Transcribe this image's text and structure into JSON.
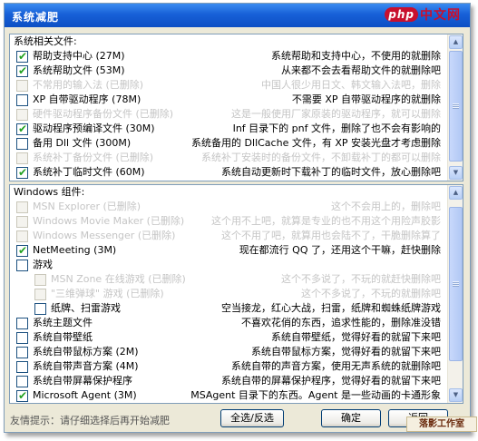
{
  "window": {
    "title": "系统减肥"
  },
  "watermark_top": {
    "logo": "php",
    "text": "中文网"
  },
  "watermark_bottom": {
    "text": "落影工作室"
  },
  "groups": {
    "system_files": {
      "label": "系统相关文件:",
      "items": [
        {
          "name": "帮助支持中心 (27M)",
          "desc": "系统帮助和支持中心，不使用的就删除",
          "checked": true,
          "disabled": false
        },
        {
          "name": "系统帮助文件 (53M)",
          "desc": "从来都不会去看帮助文件的就删除吧",
          "checked": true,
          "disabled": false
        },
        {
          "name": "不常用的输入法 (已删除)",
          "desc": "中国人很少用日文、韩文输入法吧，删除",
          "checked": false,
          "disabled": true
        },
        {
          "name": "XP 自带驱动程序 (78M)",
          "desc": "不需要 XP 自带驱动程序的就删除",
          "checked": false,
          "disabled": false
        },
        {
          "name": "硬件驱动程序备份文件 (已删除)",
          "desc": "这是一般使用厂家原装的驱动程序，就可以删除",
          "checked": false,
          "disabled": true
        },
        {
          "name": "驱动程序预编译文件 (30M)",
          "desc": "Inf 目录下的 pnf 文件，删除了也不会有影响的",
          "checked": true,
          "disabled": false
        },
        {
          "name": "备用 Dll 文件 (300M)",
          "desc": "系统备用的 DllCache 文件，有 XP 安装光盘才考虑删除",
          "checked": false,
          "disabled": false
        },
        {
          "name": "系统补丁备份文件 (已删除)",
          "desc": "系统补丁安装时的备份文件，不卸载补丁的都可以删除",
          "checked": false,
          "disabled": true
        },
        {
          "name": "系统补丁临时文件 (60M)",
          "desc": "系统自动更新时下载补丁的临时文件，放心删除吧",
          "checked": true,
          "disabled": false
        }
      ]
    },
    "windows_components": {
      "label": "Windows 组件:",
      "items": [
        {
          "name": "MSN Explorer (已删除)",
          "desc": "这个不会用上的，删除吧",
          "checked": false,
          "disabled": true,
          "indent": 0
        },
        {
          "name": "Windows Movie Maker (已删除)",
          "desc": "这个用不上吧，就算是专业的也不用这个用险声胶影",
          "checked": false,
          "disabled": true,
          "indent": 0
        },
        {
          "name": "Windows Messenger (已删除)",
          "desc": "这个不用了吧，就算用也会陆不了，干脆删除算了",
          "checked": false,
          "disabled": true,
          "indent": 0
        },
        {
          "name": "NetMeeting (3M)",
          "desc": "现在都流行 QQ 了，还用这个干嘛，赶快删除",
          "checked": true,
          "disabled": false,
          "indent": 0
        },
        {
          "name": "游戏",
          "desc": "",
          "checked": false,
          "disabled": false,
          "indent": 0
        },
        {
          "name": "MSN Zone 在线游戏 (已删除)",
          "desc": "这个不多说了，不玩的就赶快删除吧",
          "checked": false,
          "disabled": true,
          "indent": 1
        },
        {
          "name": "\"三维弹球\" 游戏 (已删除)",
          "desc": "这个不多说了，不玩的就删除吧",
          "checked": false,
          "disabled": true,
          "indent": 1
        },
        {
          "name": "纸牌、扫雷游戏",
          "desc": "空当接龙，红心大战，扫雷，纸牌和蜘蛛纸牌游戏",
          "checked": false,
          "disabled": false,
          "indent": 1
        },
        {
          "name": "系统主题文件",
          "desc": "不喜欢花俏的东西，追求性能的，删除准没错",
          "checked": false,
          "disabled": false,
          "indent": 0
        },
        {
          "name": "系统自带壁纸",
          "desc": "系统自带壁纸，觉得好看的就留下来吧",
          "checked": false,
          "disabled": false,
          "indent": 0
        },
        {
          "name": "系统自带鼠标方案 (2M)",
          "desc": "系统自带鼠标方案，觉得好看的就留下来吧",
          "checked": false,
          "disabled": false,
          "indent": 0
        },
        {
          "name": "系统自带声音方案 (4M)",
          "desc": "系统自带的声音方案，使用无声系统的就删除吧",
          "checked": false,
          "disabled": false,
          "indent": 0
        },
        {
          "name": "系统自带屏幕保护程序",
          "desc": "系统自带的屏幕保护程序，觉得好看的就留下来吧",
          "checked": false,
          "disabled": false,
          "indent": 0
        },
        {
          "name": "Microsoft Agent (3M)",
          "desc": "MSAgent 目录下的东西。Agent 是一些动画的卡通形象",
          "checked": true,
          "disabled": false,
          "indent": 0
        }
      ]
    }
  },
  "footer": {
    "tip": "友情提示：请仔细选择后再开始减肥",
    "select_all_label": "全选/反选",
    "ok_label": "确定",
    "back_label": "返回"
  },
  "icons": {
    "check": "check-mark",
    "scroll_up": "arrow-up",
    "scroll_down": "arrow-down"
  }
}
